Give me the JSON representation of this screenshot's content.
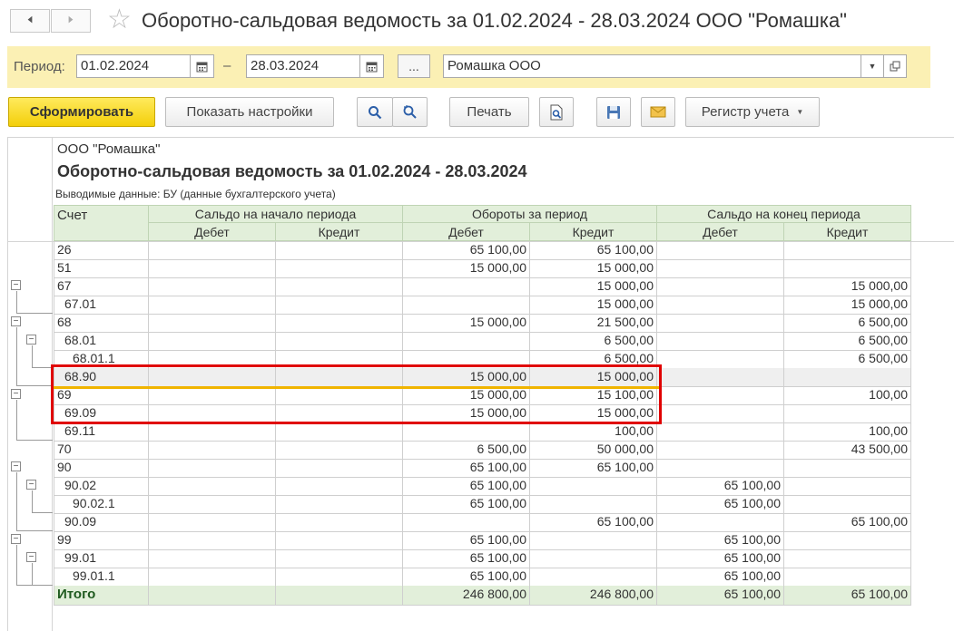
{
  "window": {
    "title": "Оборотно-сальдовая ведомость за 01.02.2024 - 28.03.2024 ООО \"Ромашка\"",
    "back_icon": "arrow-left",
    "forward_icon": "arrow-right",
    "favorite_icon": "star"
  },
  "period_bar": {
    "label": "Период:",
    "date_from": "01.02.2024",
    "separator": "–",
    "date_to": "28.03.2024",
    "more_label": "...",
    "organization": "Ромашка ООО"
  },
  "toolbar": {
    "generate_label": "Сформировать",
    "settings_label": "Показать настройки",
    "print_label": "Печать",
    "register_label": "Регистр учета"
  },
  "report": {
    "org": "ООО \"Ромашка\"",
    "title": "Оборотно-сальдовая ведомость за 01.02.2024 - 28.03.2024",
    "subtitle": "Выводимые данные:  БУ (данные бухгалтерского учета)",
    "headers": {
      "account": "Счет",
      "opening": "Сальдо на начало периода",
      "turnover": "Обороты за период",
      "closing": "Сальдо на конец периода",
      "debit": "Дебет",
      "credit": "Кредит"
    },
    "rows": [
      {
        "account": "26",
        "level": 0,
        "cols": [
          "",
          "",
          "65 100,00",
          "65 100,00",
          "",
          ""
        ]
      },
      {
        "account": "51",
        "level": 0,
        "cols": [
          "",
          "",
          "15 000,00",
          "15 000,00",
          "",
          ""
        ]
      },
      {
        "account": "67",
        "level": 0,
        "cols": [
          "",
          "",
          "",
          "15 000,00",
          "",
          "15 000,00"
        ]
      },
      {
        "account": "67.01",
        "level": 1,
        "cols": [
          "",
          "",
          "",
          "15 000,00",
          "",
          "15 000,00"
        ]
      },
      {
        "account": "68",
        "level": 0,
        "cols": [
          "",
          "",
          "15 000,00",
          "21 500,00",
          "",
          "6 500,00"
        ]
      },
      {
        "account": "68.01",
        "level": 1,
        "cols": [
          "",
          "",
          "",
          "6 500,00",
          "",
          "6 500,00"
        ]
      },
      {
        "account": "68.01.1",
        "level": 2,
        "cols": [
          "",
          "",
          "",
          "6 500,00",
          "",
          "6 500,00"
        ]
      },
      {
        "account": "68.90",
        "level": 1,
        "cols": [
          "",
          "",
          "15 000,00",
          "15 000,00",
          "",
          ""
        ]
      },
      {
        "account": "69",
        "level": 0,
        "cols": [
          "",
          "",
          "15 000,00",
          "15 100,00",
          "",
          "100,00"
        ]
      },
      {
        "account": "69.09",
        "level": 1,
        "cols": [
          "",
          "",
          "15 000,00",
          "15 000,00",
          "",
          ""
        ]
      },
      {
        "account": "69.11",
        "level": 1,
        "cols": [
          "",
          "",
          "",
          "100,00",
          "",
          "100,00"
        ]
      },
      {
        "account": "70",
        "level": 0,
        "cols": [
          "",
          "",
          "6 500,00",
          "50 000,00",
          "",
          "43 500,00"
        ]
      },
      {
        "account": "90",
        "level": 0,
        "cols": [
          "",
          "",
          "65 100,00",
          "65 100,00",
          "",
          ""
        ]
      },
      {
        "account": "90.02",
        "level": 1,
        "cols": [
          "",
          "",
          "65 100,00",
          "",
          "65 100,00",
          ""
        ]
      },
      {
        "account": "90.02.1",
        "level": 2,
        "cols": [
          "",
          "",
          "65 100,00",
          "",
          "65 100,00",
          ""
        ]
      },
      {
        "account": "90.09",
        "level": 1,
        "cols": [
          "",
          "",
          "",
          "65 100,00",
          "",
          "65 100,00"
        ]
      },
      {
        "account": "99",
        "level": 0,
        "cols": [
          "",
          "",
          "65 100,00",
          "",
          "65 100,00",
          ""
        ]
      },
      {
        "account": "99.01",
        "level": 1,
        "cols": [
          "",
          "",
          "65 100,00",
          "",
          "65 100,00",
          ""
        ]
      },
      {
        "account": "99.01.1",
        "level": 2,
        "cols": [
          "",
          "",
          "65 100,00",
          "",
          "65 100,00",
          ""
        ]
      }
    ],
    "total": {
      "account": "Итого",
      "cols": [
        "",
        "",
        "246 800,00",
        "246 800,00",
        "65 100,00",
        "65 100,00"
      ]
    }
  },
  "colors": {
    "period_bar_bg": "#fbf0b4",
    "primary_button": "#f5d327",
    "header_bg": "#e2efda",
    "highlight_border": "#e00000",
    "selection_line": "#f0b400"
  }
}
